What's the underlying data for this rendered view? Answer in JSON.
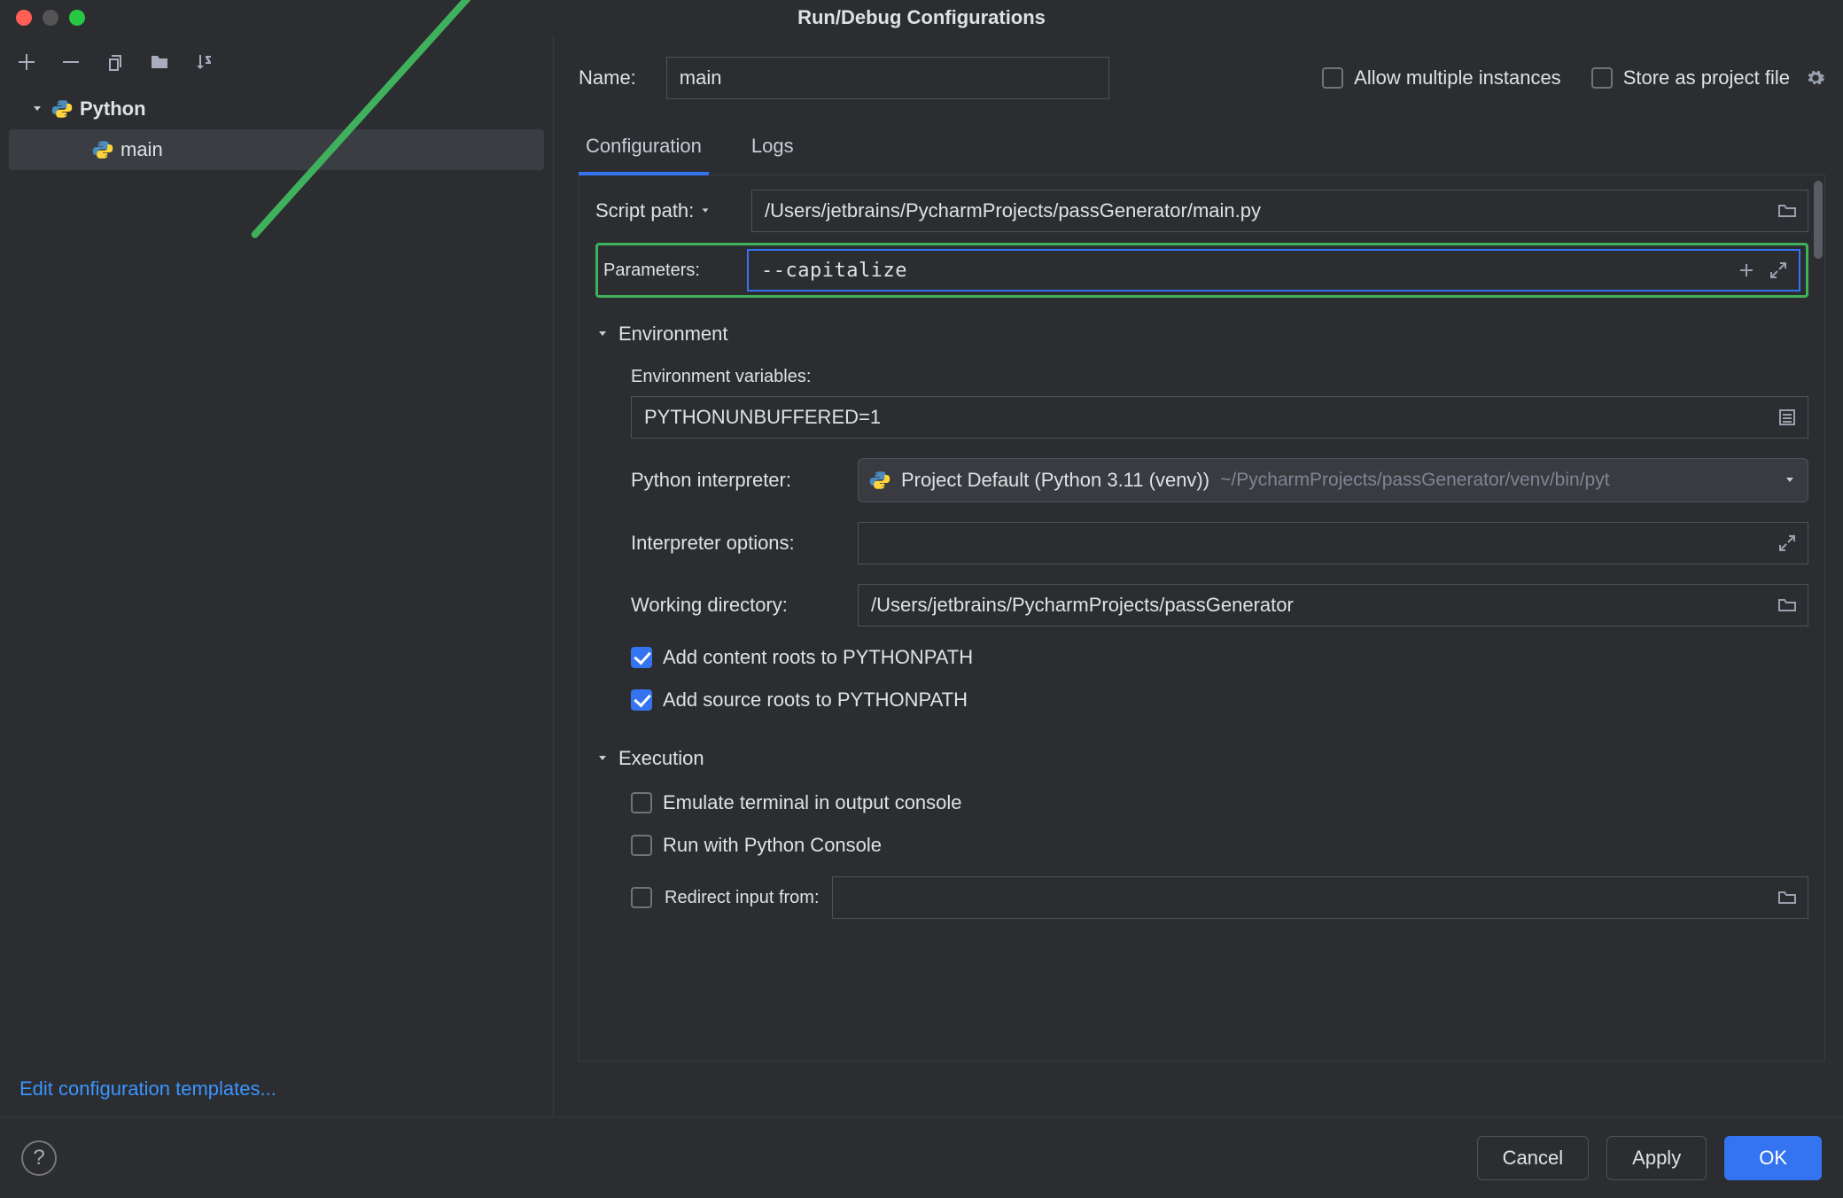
{
  "window": {
    "title": "Run/Debug Configurations"
  },
  "sidebar": {
    "top_label": "Python",
    "items": [
      {
        "label": "main"
      }
    ],
    "edit_templates_label": "Edit configuration templates..."
  },
  "header": {
    "name_label": "Name:",
    "name_value": "main",
    "allow_multiple_label": "Allow multiple instances",
    "allow_multiple_checked": false,
    "store_as_project_file_label": "Store as project file",
    "store_as_project_file_checked": false
  },
  "tabs": {
    "configuration_label": "Configuration",
    "logs_label": "Logs"
  },
  "config": {
    "script_path_label": "Script path:",
    "script_path_value": "/Users/jetbrains/PycharmProjects/passGenerator/main.py",
    "parameters_label": "Parameters:",
    "parameters_value": "--capitalize",
    "environment_section_label": "Environment",
    "env_vars_label": "Environment variables:",
    "env_vars_value": "PYTHONUNBUFFERED=1",
    "interpreter_label": "Python interpreter:",
    "interpreter_primary": "Project Default (Python 3.11 (venv))",
    "interpreter_hint": "~/PycharmProjects/passGenerator/venv/bin/pyt",
    "interp_options_label": "Interpreter options:",
    "interp_options_value": "",
    "working_dir_label": "Working directory:",
    "working_dir_value": "/Users/jetbrains/PycharmProjects/passGenerator",
    "add_content_roots_label": "Add content roots to PYTHONPATH",
    "add_content_roots_checked": true,
    "add_source_roots_label": "Add source roots to PYTHONPATH",
    "add_source_roots_checked": true,
    "execution_section_label": "Execution",
    "emulate_terminal_label": "Emulate terminal in output console",
    "emulate_terminal_checked": false,
    "run_with_console_label": "Run with Python Console",
    "run_with_console_checked": false,
    "redirect_input_label": "Redirect input from:",
    "redirect_input_checked": false,
    "redirect_input_value": ""
  },
  "buttons": {
    "cancel_label": "Cancel",
    "apply_label": "Apply",
    "ok_label": "OK",
    "help_label": "?"
  }
}
